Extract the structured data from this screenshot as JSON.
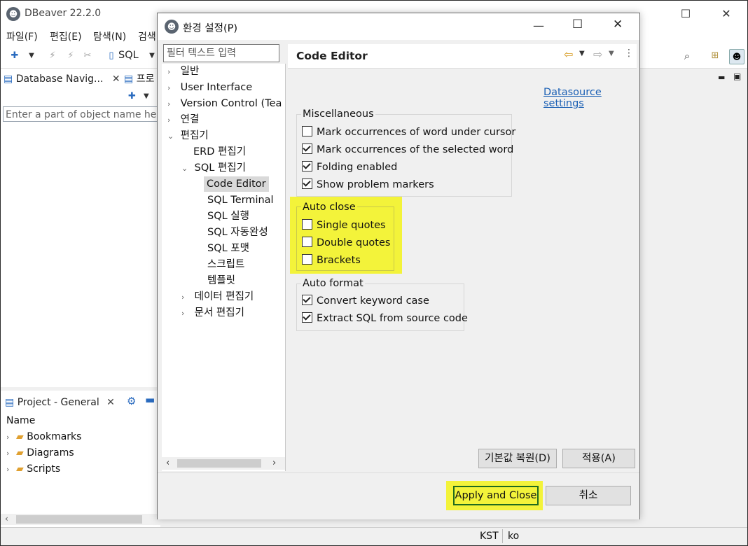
{
  "app": {
    "title": "DBeaver 22.2.0",
    "menu": [
      "파일(F)",
      "편집(E)",
      "탐색(N)",
      "검색"
    ],
    "toolbar": {
      "sql_label": "SQL"
    },
    "nav_tabs": {
      "database_navigator": "Database Navig...",
      "projects": "프로"
    },
    "filter_placeholder": "Enter a part of object name here",
    "project_tab": "Project - General",
    "project_column": "Name",
    "project_items": [
      "Bookmarks",
      "Diagrams",
      "Scripts"
    ],
    "status": {
      "timezone": "KST",
      "locale": "ko"
    }
  },
  "dialog": {
    "title": "환경 설정(P)",
    "filter_placeholder": "필터 텍스트 입력",
    "tree": {
      "general": "일반",
      "user_interface": "User Interface",
      "version_control": "Version Control (Tea",
      "connections": "연결",
      "editors": "편집기",
      "erd_editor": "ERD 편집기",
      "sql_editor": "SQL 편집기",
      "code_editor": "Code Editor",
      "sql_terminal": "SQL Terminal",
      "sql_execute": "SQL 실행",
      "sql_completion": "SQL 자동완성",
      "sql_format": "SQL 포맷",
      "script": "스크립트",
      "template": "템플릿",
      "data_editor": "데이터 편집기",
      "doc_editor": "문서 편집기"
    },
    "page_title": "Code Editor",
    "datasource_link": "Datasource settings",
    "misc": {
      "title": "Miscellaneous",
      "items": [
        {
          "label": "Mark occurrences of word under cursor",
          "checked": false
        },
        {
          "label": "Mark occurrences of the selected word",
          "checked": true
        },
        {
          "label": "Folding enabled",
          "checked": true
        },
        {
          "label": "Show problem markers",
          "checked": true
        }
      ]
    },
    "auto_close": {
      "title": "Auto close",
      "items": [
        {
          "label": "Single quotes",
          "checked": false
        },
        {
          "label": "Double quotes",
          "checked": false
        },
        {
          "label": "Brackets",
          "checked": false
        }
      ]
    },
    "auto_format": {
      "title": "Auto format",
      "items": [
        {
          "label": "Convert keyword case",
          "checked": true
        },
        {
          "label": "Extract SQL from source code",
          "checked": true
        }
      ]
    },
    "buttons": {
      "restore_defaults": "기본값 복원(D)",
      "apply": "적용(A)",
      "apply_close": "Apply and Close",
      "cancel": "취소"
    },
    "highlight_color": "#f3f33a"
  }
}
